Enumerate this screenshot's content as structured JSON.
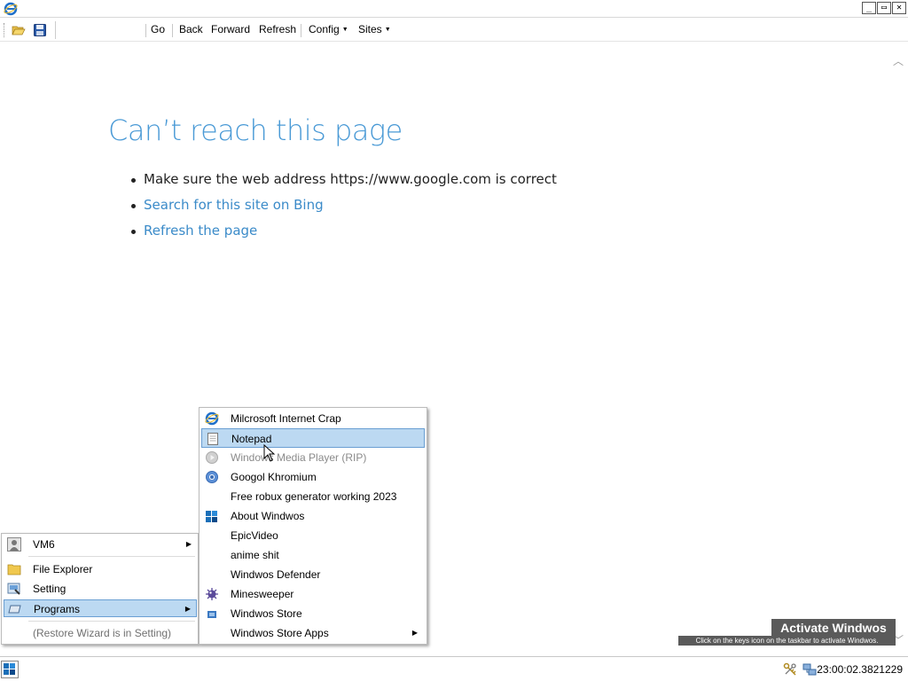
{
  "titlebar": {
    "app_icon": "internet-explorer-icon",
    "buttons": [
      "_",
      "▭",
      "✕"
    ]
  },
  "toolbar": {
    "open_icon": "folder-open-icon",
    "save_icon": "floppy-disk-icon",
    "address_value": "",
    "items": {
      "go": "Go",
      "back": "Back",
      "forward": "Forward",
      "refresh": "Refresh",
      "config": "Config",
      "sites": "Sites"
    }
  },
  "page": {
    "title": "Can’t reach this page",
    "bullets": [
      "Make sure the web address https://www.google.com is correct",
      "Search for this site on Bing",
      "Refresh the page"
    ]
  },
  "start_menu": {
    "items": [
      {
        "label": "VM6",
        "icon": "user-icon",
        "has_submenu": true
      },
      {
        "label": "File Explorer",
        "icon": "folder-icon"
      },
      {
        "label": "Setting",
        "icon": "settings-icon"
      },
      {
        "label": "Programs",
        "icon": "programs-icon",
        "has_submenu": true,
        "highlighted": true
      },
      {
        "label": "(Restore Wizard is in Setting)",
        "disabled": true
      }
    ]
  },
  "programs_menu": {
    "items": [
      {
        "label": "Milcrosoft Internet Crap",
        "icon": "internet-explorer-icon"
      },
      {
        "label": "Notepad",
        "icon": "notepad-icon",
        "highlighted": true
      },
      {
        "label": "Windows Media Player (RIP)",
        "icon": "media-player-icon",
        "disabled": true
      },
      {
        "label": "Googol Khromium",
        "icon": "chromium-icon"
      },
      {
        "label": "Free robux generator working 2023"
      },
      {
        "label": "About Windwos",
        "icon": "windows-icon"
      },
      {
        "label": "EpicVideo"
      },
      {
        "label": "anime shit"
      },
      {
        "label": "Windwos Defender"
      },
      {
        "label": "Minesweeper",
        "icon": "minesweeper-icon"
      },
      {
        "label": "Windwos Store",
        "icon": "store-icon"
      },
      {
        "label": "Windwos Store Apps",
        "has_submenu": true
      }
    ]
  },
  "watermark": {
    "title": "Activate Windwos",
    "subtitle": "Click on the keys icon on the taskbar to activate Windwos."
  },
  "taskbar": {
    "clock": "23:00:02.3821229",
    "tray_icons": [
      "keys-icon",
      "network-icon"
    ]
  }
}
